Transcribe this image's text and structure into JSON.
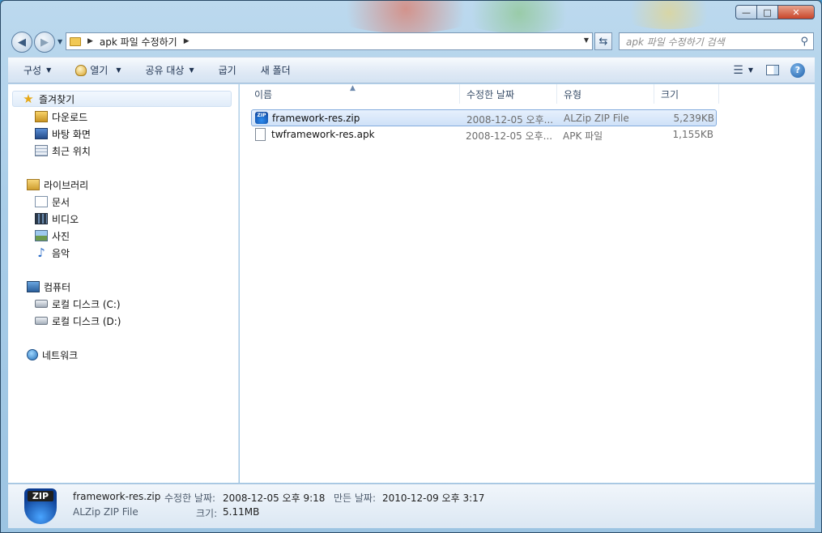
{
  "window": {
    "caption_icons": [
      "minimize-icon",
      "maximize-icon",
      "close-icon"
    ]
  },
  "address": {
    "path": "apk 파일 수정하기",
    "search_placeholder": "apk 파일 수정하기 검색"
  },
  "commandbar": {
    "organize": "구성",
    "open": "열기",
    "share": "공유 대상",
    "burn": "굽기",
    "new_folder": "새 폴더"
  },
  "navpane": {
    "favorites": "즐겨찾기",
    "downloads": "다운로드",
    "desktop": "바탕 화면",
    "recent": "최근 위치",
    "libraries": "라이브러리",
    "documents": "문서",
    "videos": "비디오",
    "pictures": "사진",
    "music": "음악",
    "computer": "컴퓨터",
    "drive_c": "로컬 디스크 (C:)",
    "drive_d": "로컬 디스크 (D:)",
    "network": "네트워크"
  },
  "columns": {
    "name": "이름",
    "date": "수정한 날짜",
    "type": "유형",
    "size": "크기"
  },
  "files": [
    {
      "name": "framework-res.zip",
      "date": "2008-12-05 오후...",
      "type": "ALZip ZIP File",
      "size": "5,239KB",
      "icon": "zip-icon",
      "selected": true
    },
    {
      "name": "twframework-res.apk",
      "date": "2008-12-05 오후...",
      "type": "APK 파일",
      "size": "1,155KB",
      "icon": "file-icon",
      "selected": false
    }
  ],
  "details": {
    "icon_label": "ZIP",
    "filename": "framework-res.zip",
    "filetype": "ALZip ZIP File",
    "modified_label": "수정한 날짜:",
    "modified_value": "2008-12-05 오후 9:18",
    "created_label": "만든 날짜:",
    "created_value": "2010-12-09 오후 3:17",
    "size_label": "크기:",
    "size_value": "5.11MB"
  },
  "zip_icon_text": "ZIP"
}
